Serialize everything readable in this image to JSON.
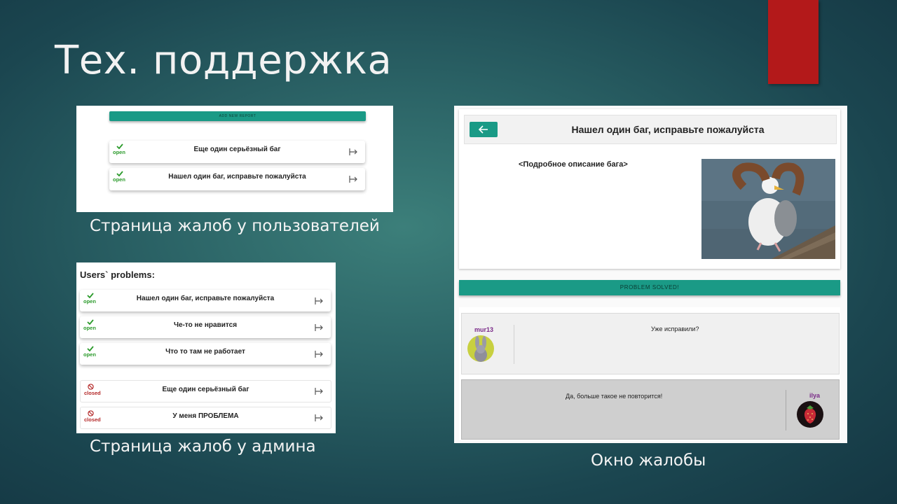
{
  "slide": {
    "title": "Тех. поддержка",
    "accent_color": "#b3191a"
  },
  "captions": {
    "user_page": "Страница жалоб у пользователей",
    "admin_page": "Страница жалоб у админа",
    "complaint_window": "Окно жалобы"
  },
  "user_panel": {
    "add_button": "ADD NEW REPORT",
    "reports": [
      {
        "status": "open",
        "title": "Еще один серьёзный баг",
        "icon": "check-icon"
      },
      {
        "status": "open",
        "title": "Нашел один баг, исправьте пожалуйста",
        "icon": "check-icon"
      }
    ]
  },
  "admin_panel": {
    "heading": "Users` problems:",
    "reports": [
      {
        "status": "open",
        "title": "Нашел один баг, исправьте пожалуйста",
        "icon": "check-icon"
      },
      {
        "status": "open",
        "title": "Че-то не нравится",
        "icon": "check-icon"
      },
      {
        "status": "open",
        "title": "Что то там не работает",
        "icon": "check-icon"
      },
      {
        "status": "closed",
        "title": "Еще один серьёзный баг",
        "icon": "blocked-icon"
      },
      {
        "status": "closed",
        "title": "У меня ПРОБЛЕМА",
        "icon": "blocked-icon"
      }
    ]
  },
  "complaint": {
    "title": "Нашел один баг, исправьте пожалуйста",
    "description": "<Подробное описание бага>",
    "solve_button": "PROBLEM SOLVED!",
    "messages": [
      {
        "user": "mur13",
        "text": "Уже исправили?"
      },
      {
        "user": "ilya",
        "text": "Да, больше такое не повторится!"
      }
    ]
  },
  "colors": {
    "primary_button": "#1a9a86",
    "open_status": "#2a9a2a",
    "closed_status": "#b42828",
    "username": "#7a2a88"
  }
}
